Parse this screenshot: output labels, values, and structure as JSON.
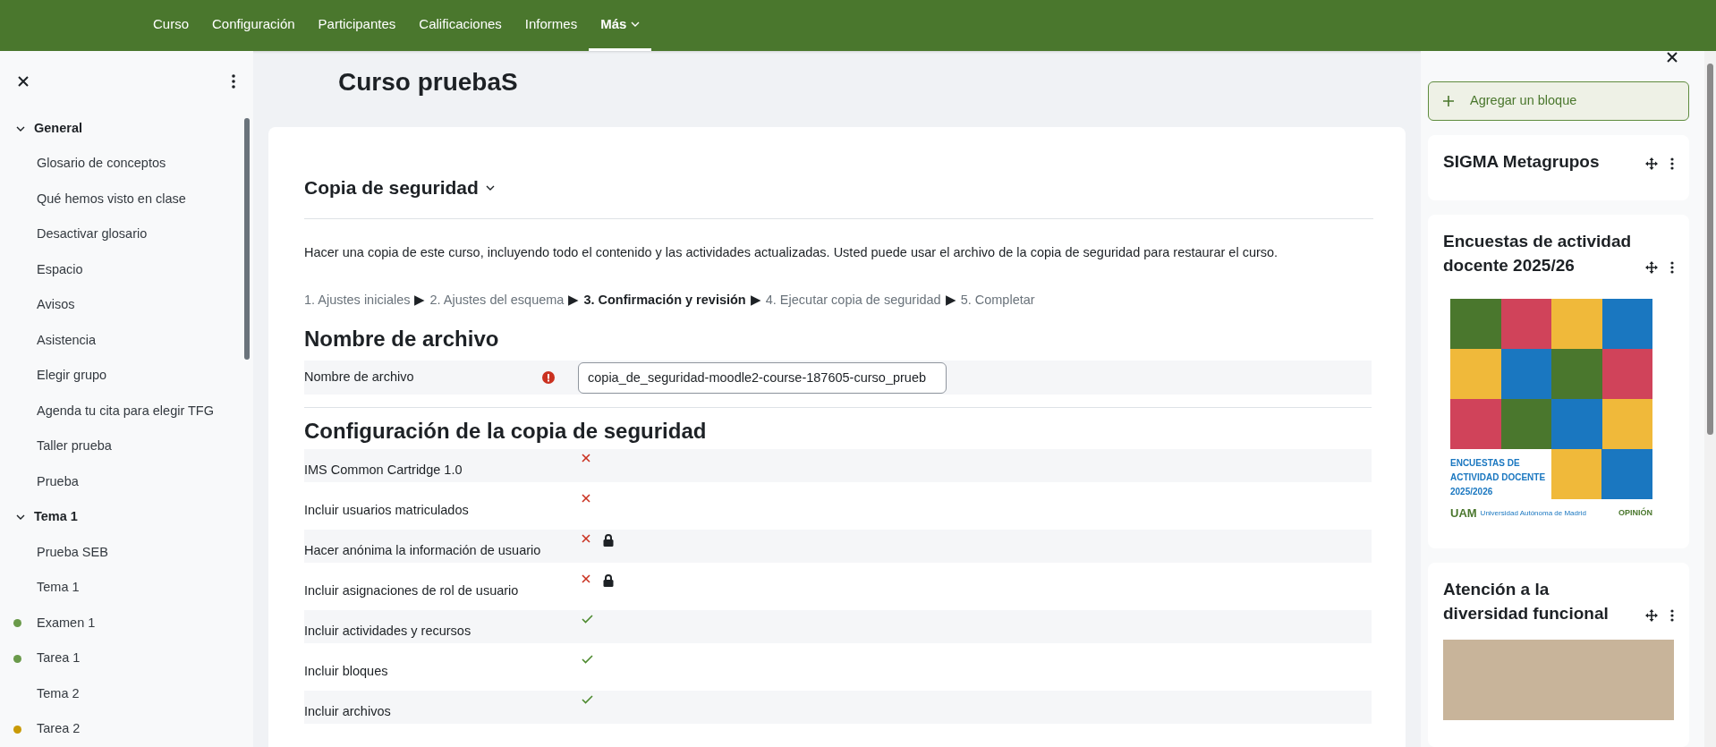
{
  "nav": {
    "items": [
      {
        "label": "Curso",
        "selected": false
      },
      {
        "label": "Configuración",
        "selected": false
      },
      {
        "label": "Participantes",
        "selected": false
      },
      {
        "label": "Calificaciones",
        "selected": false
      },
      {
        "label": "Informes",
        "selected": false
      },
      {
        "label": "Más",
        "selected": true,
        "dropdown": true
      }
    ]
  },
  "course_index": {
    "sections": [
      {
        "title": "General",
        "expanded": true,
        "items": [
          {
            "label": "Glosario de conceptos"
          },
          {
            "label": "Qué hemos visto en clase"
          },
          {
            "label": "Desactivar glosario"
          },
          {
            "label": "Espacio"
          },
          {
            "label": "Avisos"
          },
          {
            "label": "Asistencia"
          },
          {
            "label": "Elegir grupo"
          },
          {
            "label": "Agenda tu cita para elegir TFG"
          },
          {
            "label": "Taller prueba"
          },
          {
            "label": "Prueba"
          }
        ]
      },
      {
        "title": "Tema 1",
        "expanded": true,
        "items": [
          {
            "label": "Prueba SEB"
          },
          {
            "label": "Tema 1"
          },
          {
            "label": "Examen 1",
            "color": "#6a9a4a"
          },
          {
            "label": "Tarea 1",
            "color": "#6a9a4a"
          },
          {
            "label": "Tema 2"
          },
          {
            "label": "Tarea 2",
            "color": "#c99a06"
          }
        ]
      }
    ]
  },
  "page_title": "Curso pruebaS",
  "main": {
    "heading": "Copia de seguridad",
    "description": "Hacer una copia de este curso, incluyendo todo el contenido y las actividades actualizadas. Usted puede usar el archivo de la copia de seguridad para restaurar el curso.",
    "steps": {
      "separator": "▶",
      "items": [
        {
          "label": "1. Ajustes iniciales",
          "selected": false
        },
        {
          "label": "2. Ajustes del esquema",
          "selected": false
        },
        {
          "label": "3. Confirmación y revisión",
          "selected": true
        },
        {
          "label": "4. Ejecutar copia de seguridad",
          "selected": false
        },
        {
          "label": "5. Completar",
          "selected": false
        }
      ]
    },
    "filename_section": {
      "title": "Nombre de archivo",
      "label": "Nombre de archivo",
      "required": true,
      "value": "copia_de_seguridad-moodle2-course-187605-curso_prueb"
    },
    "settings_section": {
      "title": "Configuración de la copia de seguridad",
      "rows": [
        {
          "label": "IMS Common Cartridge 1.0",
          "checked": false,
          "locked": false
        },
        {
          "label": "Incluir usuarios matriculados",
          "checked": false,
          "locked": false
        },
        {
          "label": "Hacer anónima la información de usuario",
          "checked": false,
          "locked": true
        },
        {
          "label": "Incluir asignaciones de rol de usuario",
          "checked": false,
          "locked": true
        },
        {
          "label": "Incluir actividades y recursos",
          "checked": true,
          "locked": false
        },
        {
          "label": "Incluir bloques",
          "checked": true,
          "locked": false
        },
        {
          "label": "Incluir archivos",
          "checked": true,
          "locked": false
        }
      ]
    }
  },
  "blocks_drawer": {
    "add_block": "Agregar un bloque",
    "blocks": [
      {
        "kind": "empty",
        "title": "SIGMA Metagrupos"
      },
      {
        "kind": "poster",
        "title": "Encuestas de actividad docente 2025/26",
        "poster_caption": "ENCUESTAS DE ACTIVIDAD DOCENTE 2025/2026",
        "logo": "UAM",
        "logo_text": "Universidad Autónoma de Madrid",
        "badge": "OPINIÓN"
      },
      {
        "kind": "photo",
        "title": "Atención a la diversidad funcional"
      }
    ]
  }
}
